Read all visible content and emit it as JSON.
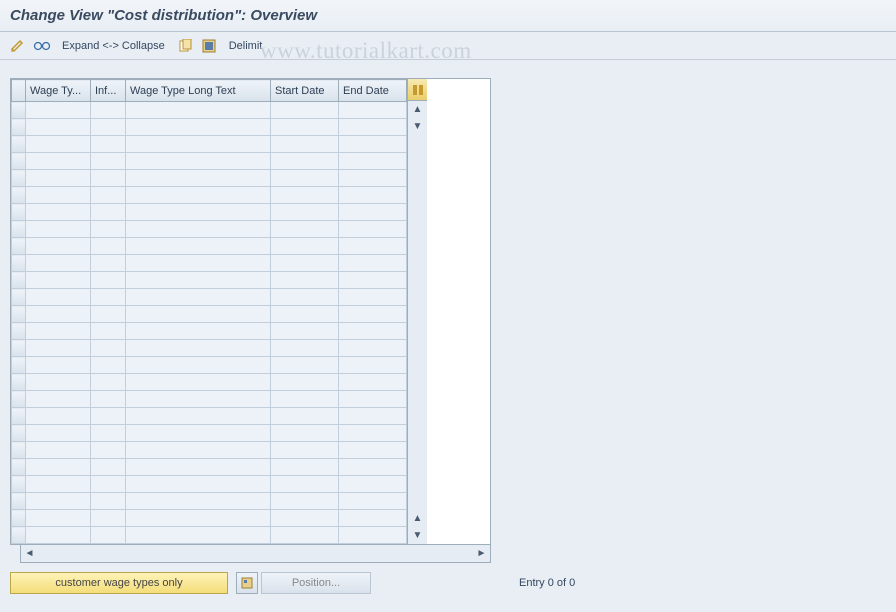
{
  "title": "Change View \"Cost distribution\": Overview",
  "toolbar": {
    "expand_collapse": "Expand <-> Collapse",
    "delimit": "Delimit"
  },
  "columns": {
    "wage_type": "Wage Ty...",
    "inf": "Inf...",
    "wage_long": "Wage Type Long Text",
    "start_date": "Start Date",
    "end_date": "End Date"
  },
  "row_count": 26,
  "footer": {
    "customer_btn": "customer wage types only",
    "position_btn": "Position...",
    "entry_info": "Entry 0 of 0"
  },
  "watermark": "www.tutorialkart.com"
}
